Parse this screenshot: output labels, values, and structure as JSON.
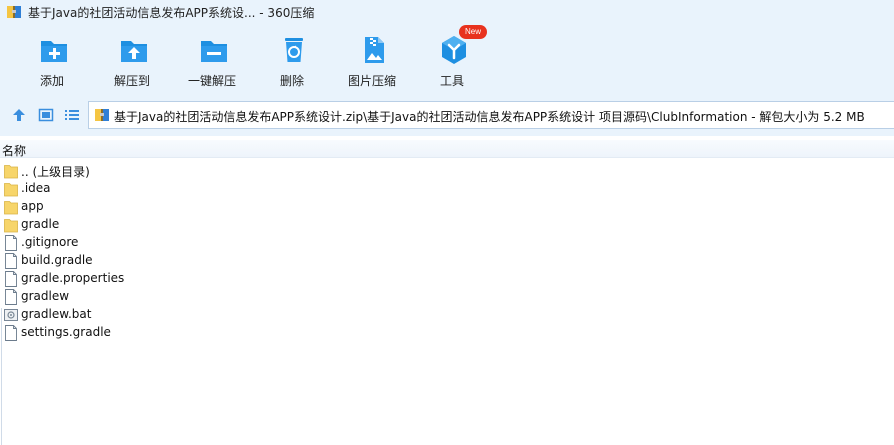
{
  "window": {
    "title": "基于Java的社团活动信息发布APP系统设... - 360压缩"
  },
  "toolbar": {
    "buttons": [
      {
        "label": "添加",
        "icon": "add-icon"
      },
      {
        "label": "解压到",
        "icon": "extract-to-icon"
      },
      {
        "label": "一键解压",
        "icon": "one-click-extract-icon"
      },
      {
        "label": "删除",
        "icon": "delete-icon"
      },
      {
        "label": "图片压缩",
        "icon": "image-compress-icon"
      },
      {
        "label": "工具",
        "icon": "tools-icon",
        "badge": "New"
      }
    ]
  },
  "navbar": {
    "path": "基于Java的社团活动信息发布APP系统设计.zip\\基于Java的社团活动信息发布APP系统设计 项目源码\\ClubInformation - 解包大小为 5.2 MB"
  },
  "list": {
    "column_name": "名称",
    "items": [
      {
        "name": ".. (上级目录)",
        "type": "folder"
      },
      {
        "name": ".idea",
        "type": "folder"
      },
      {
        "name": "app",
        "type": "folder"
      },
      {
        "name": "gradle",
        "type": "folder"
      },
      {
        "name": ".gitignore",
        "type": "file"
      },
      {
        "name": "build.gradle",
        "type": "file"
      },
      {
        "name": "gradle.properties",
        "type": "file"
      },
      {
        "name": "gradlew",
        "type": "file"
      },
      {
        "name": "gradlew.bat",
        "type": "bat"
      },
      {
        "name": "settings.gradle",
        "type": "file"
      }
    ]
  },
  "colors": {
    "chrome_bg": "#e9f3fc",
    "icon_blue": "#1e8fe1",
    "folder_yellow": "#f7d56a",
    "badge_red": "#e8321e"
  }
}
